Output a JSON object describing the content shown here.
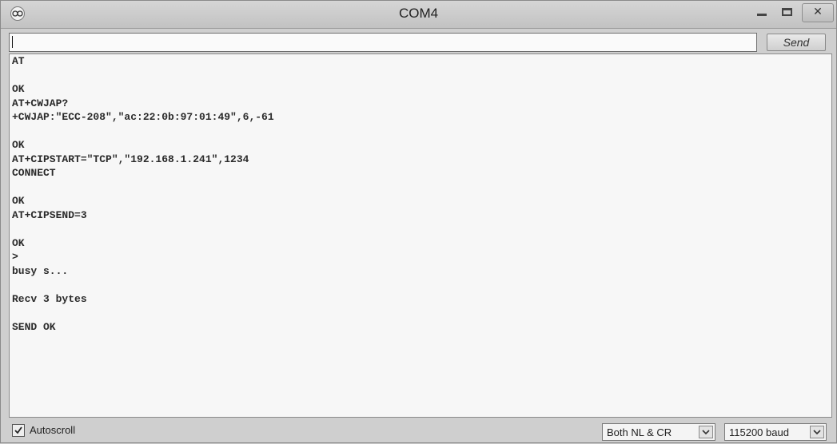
{
  "window": {
    "title": "COM4"
  },
  "send_bar": {
    "input_value": "",
    "send_label": "Send"
  },
  "output_lines": [
    "AT",
    "",
    "OK",
    "AT+CWJAP?",
    "+CWJAP:\"ECC-208\",\"ac:22:0b:97:01:49\",6,-61",
    "",
    "OK",
    "AT+CIPSTART=\"TCP\",\"192.168.1.241\",1234",
    "CONNECT",
    "",
    "OK",
    "AT+CIPSEND=3",
    "",
    "OK",
    ">",
    "busy s...",
    "",
    "Recv 3 bytes",
    "",
    "SEND OK"
  ],
  "footer": {
    "autoscroll_label": "Autoscroll",
    "autoscroll_checked": true,
    "line_ending_selected": "Both NL & CR",
    "baud_selected": "115200 baud"
  },
  "icons": {
    "app": "arduino-infinity-icon",
    "minimize": "minimize-icon",
    "maximize": "maximize-icon",
    "close": "close-icon",
    "dropdown": "chevron-down-icon",
    "checkbox": "checkmark-icon"
  }
}
